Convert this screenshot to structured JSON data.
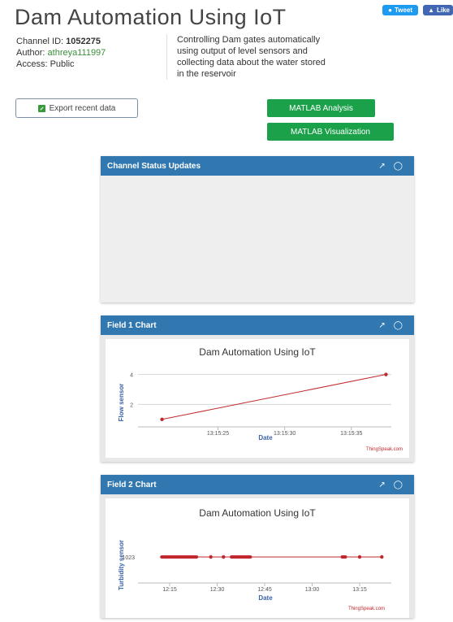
{
  "header": {
    "title": "Dam Automation Using IoT",
    "tweet_label": "Tweet",
    "like_label": "Like"
  },
  "channel": {
    "id_label": "Channel ID:",
    "id_value": "1052275",
    "author_label": "Author:",
    "author_value": "athreya111997",
    "access_label": "Access:",
    "access_value": "Public",
    "description": "Controlling Dam gates automatically using output of level sensors and collecting data about the water stored in the reservoir"
  },
  "buttons": {
    "export": "Export recent data",
    "matlab_analysis": "MATLAB Analysis",
    "matlab_visualization": "MATLAB Visualization"
  },
  "panels": {
    "status": {
      "title": "Channel Status Updates"
    },
    "field1": {
      "title": "Field 1 Chart"
    },
    "field2": {
      "title": "Field 2 Chart"
    }
  },
  "icons": {
    "edit": "external-link-icon",
    "comment": "comment-icon"
  },
  "colors": {
    "panel_header": "#3178b0",
    "green_button": "#1aa14a",
    "series": "#c0282d"
  },
  "chart_data": [
    {
      "type": "line",
      "title": "Dam Automation Using IoT",
      "xlabel": "Date",
      "ylabel": "Flow sensor",
      "credit": "ThingSpeak.com",
      "x_ticks": [
        {
          "t": 25,
          "label": "13:15:25"
        },
        {
          "t": 30,
          "label": "13:15:30"
        },
        {
          "t": 35,
          "label": "13:15:35"
        }
      ],
      "xlim": [
        19,
        38
      ],
      "y_ticks": [
        2,
        4
      ],
      "ylim": [
        0.5,
        4.3
      ],
      "points": [
        {
          "t": 20.8,
          "y": 1
        },
        {
          "t": 37.6,
          "y": 4
        }
      ]
    },
    {
      "type": "line",
      "title": "Dam Automation Using IoT",
      "xlabel": "Date",
      "ylabel": "Turbidity sensor",
      "credit": "ThingSpeak.com",
      "x_ticks": [
        {
          "t": 735,
          "label": "12:15"
        },
        {
          "t": 750,
          "label": "12:30"
        },
        {
          "t": 765,
          "label": "12:45"
        },
        {
          "t": 780,
          "label": "13:00"
        },
        {
          "t": 795,
          "label": "13:15"
        }
      ],
      "xlim": [
        725,
        805
      ],
      "y_ticks": [
        1023
      ],
      "ylim": [
        1022,
        1024
      ],
      "value": 1023,
      "dense_ranges": [
        [
          732,
          744
        ],
        [
          754,
          761
        ],
        [
          789,
          791
        ]
      ],
      "points": [
        748,
        752,
        795,
        802
      ]
    }
  ]
}
